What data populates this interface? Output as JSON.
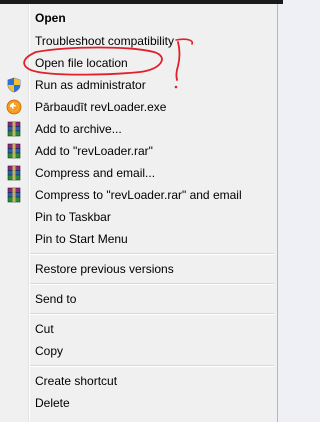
{
  "menu": {
    "items": [
      {
        "label": "Open"
      },
      {
        "label": "Troubleshoot compatibility"
      },
      {
        "label": "Open file location"
      },
      {
        "label": "Run as administrator"
      },
      {
        "label": "Pārbaudīt revLoader.exe"
      },
      {
        "label": "Add to archive..."
      },
      {
        "label": "Add to \"revLoader.rar\""
      },
      {
        "label": "Compress and email..."
      },
      {
        "label": "Compress to \"revLoader.rar\" and email"
      },
      {
        "label": "Pin to Taskbar"
      },
      {
        "label": "Pin to Start Menu"
      },
      {
        "label": "Restore previous versions"
      },
      {
        "label": "Send to"
      },
      {
        "label": "Cut"
      },
      {
        "label": "Copy"
      },
      {
        "label": "Create shortcut"
      },
      {
        "label": "Delete"
      }
    ]
  },
  "colors": {
    "annotation": "#e0202a",
    "menu_bg": "#f0f0f0"
  },
  "icons": [
    "shield-icon",
    "antivirus-scan-icon",
    "winrar-archive-icon"
  ]
}
